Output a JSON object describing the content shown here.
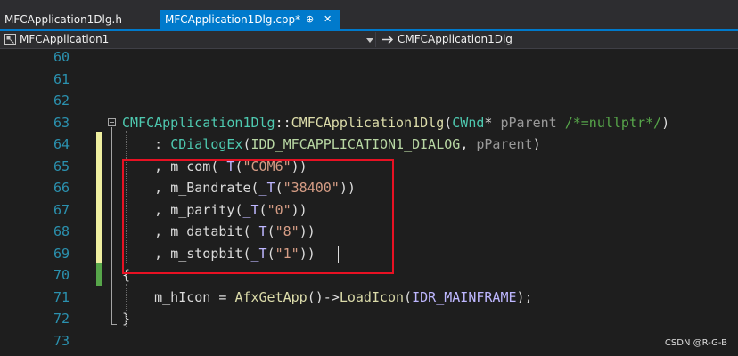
{
  "tabs": [
    {
      "label": "MFCApplication1Dlg.h",
      "active": false
    },
    {
      "label": "MFCApplication1Dlg.cpp*",
      "active": true,
      "pin": "⊕",
      "close": "✕"
    }
  ],
  "nav": {
    "project": "MFCApplication1",
    "scope": "CMFCApplication1Dlg",
    "project_icon": "class-view-icon",
    "scope_icon": "arrow-right-icon"
  },
  "lines": [
    {
      "num": "60",
      "tokens": []
    },
    {
      "num": "61",
      "tokens": []
    },
    {
      "num": "62",
      "tokens": []
    },
    {
      "num": "63",
      "tokens": [
        {
          "t": "CMFCApplication1Dlg",
          "c": "#4ec9b0"
        },
        {
          "t": "::",
          "c": "#dcdcdc"
        },
        {
          "t": "CMFCApplication1Dlg",
          "c": "#dcdcaa"
        },
        {
          "t": "(",
          "c": "#dcdcdc"
        },
        {
          "t": "CWnd",
          "c": "#4ec9b0"
        },
        {
          "t": "* ",
          "c": "#dcdcdc"
        },
        {
          "t": "pParent",
          "c": "#9a9a9a"
        },
        {
          "t": " /*=nullptr*/",
          "c": "#57a64a"
        },
        {
          "t": ")",
          "c": "#dcdcdc"
        }
      ]
    },
    {
      "num": "64",
      "tokens": [
        {
          "t": "    : ",
          "c": "#dcdcdc"
        },
        {
          "t": "CDialogEx",
          "c": "#4ec9b0"
        },
        {
          "t": "(",
          "c": "#dcdcdc"
        },
        {
          "t": "IDD_MFCAPPLICATION1_DIALOG",
          "c": "#b8d7a3"
        },
        {
          "t": ", ",
          "c": "#dcdcdc"
        },
        {
          "t": "pParent",
          "c": "#9a9a9a"
        },
        {
          "t": ")",
          "c": "#dcdcdc"
        }
      ]
    },
    {
      "num": "65",
      "tokens": [
        {
          "t": "    , ",
          "c": "#dcdcdc"
        },
        {
          "t": "m_com",
          "c": "#dadada"
        },
        {
          "t": "(",
          "c": "#dcdcdc"
        },
        {
          "t": "_T",
          "c": "#beb7ff"
        },
        {
          "t": "(",
          "c": "#dcdcdc"
        },
        {
          "t": "\"COM6\"",
          "c": "#d69d85"
        },
        {
          "t": "))",
          "c": "#dcdcdc"
        }
      ]
    },
    {
      "num": "66",
      "tokens": [
        {
          "t": "    , ",
          "c": "#dcdcdc"
        },
        {
          "t": "m_Bandrate",
          "c": "#dadada"
        },
        {
          "t": "(",
          "c": "#dcdcdc"
        },
        {
          "t": "_T",
          "c": "#beb7ff"
        },
        {
          "t": "(",
          "c": "#dcdcdc"
        },
        {
          "t": "\"38400\"",
          "c": "#d69d85"
        },
        {
          "t": "))",
          "c": "#dcdcdc"
        }
      ]
    },
    {
      "num": "67",
      "tokens": [
        {
          "t": "    , ",
          "c": "#dcdcdc"
        },
        {
          "t": "m_parity",
          "c": "#dadada"
        },
        {
          "t": "(",
          "c": "#dcdcdc"
        },
        {
          "t": "_T",
          "c": "#beb7ff"
        },
        {
          "t": "(",
          "c": "#dcdcdc"
        },
        {
          "t": "\"0\"",
          "c": "#d69d85"
        },
        {
          "t": "))",
          "c": "#dcdcdc"
        }
      ]
    },
    {
      "num": "68",
      "tokens": [
        {
          "t": "    , ",
          "c": "#dcdcdc"
        },
        {
          "t": "m_databit",
          "c": "#dadada"
        },
        {
          "t": "(",
          "c": "#dcdcdc"
        },
        {
          "t": "_T",
          "c": "#beb7ff"
        },
        {
          "t": "(",
          "c": "#dcdcdc"
        },
        {
          "t": "\"8\"",
          "c": "#d69d85"
        },
        {
          "t": "))",
          "c": "#dcdcdc"
        }
      ]
    },
    {
      "num": "69",
      "tokens": [
        {
          "t": "    , ",
          "c": "#dcdcdc"
        },
        {
          "t": "m_stopbit",
          "c": "#dadada"
        },
        {
          "t": "(",
          "c": "#dcdcdc"
        },
        {
          "t": "_T",
          "c": "#beb7ff"
        },
        {
          "t": "(",
          "c": "#dcdcdc"
        },
        {
          "t": "\"1\"",
          "c": "#d69d85"
        },
        {
          "t": "))",
          "c": "#dcdcdc"
        }
      ]
    },
    {
      "num": "70",
      "tokens": [
        {
          "t": "{",
          "c": "#dcdcdc"
        }
      ]
    },
    {
      "num": "71",
      "tokens": [
        {
          "t": "    ",
          "c": "#dcdcdc"
        },
        {
          "t": "m_hIcon",
          "c": "#dadada"
        },
        {
          "t": " = ",
          "c": "#dcdcdc"
        },
        {
          "t": "AfxGetApp",
          "c": "#dcdcaa"
        },
        {
          "t": "()->",
          "c": "#dcdcdc"
        },
        {
          "t": "LoadIcon",
          "c": "#dcdcaa"
        },
        {
          "t": "(",
          "c": "#dcdcdc"
        },
        {
          "t": "IDR_MAINFRAME",
          "c": "#beb7ff"
        },
        {
          "t": ");",
          "c": "#dcdcdc"
        }
      ]
    },
    {
      "num": "72",
      "tokens": [
        {
          "t": "}",
          "c": "#dcdcdc"
        }
      ]
    },
    {
      "num": "73",
      "tokens": []
    }
  ],
  "watermark": "CSDN @R-G-B",
  "colors": {
    "accent": "#007acc",
    "highlight_box": "#e81123",
    "change_saved": "#57a64a",
    "change_unsaved": "#efefa0"
  }
}
